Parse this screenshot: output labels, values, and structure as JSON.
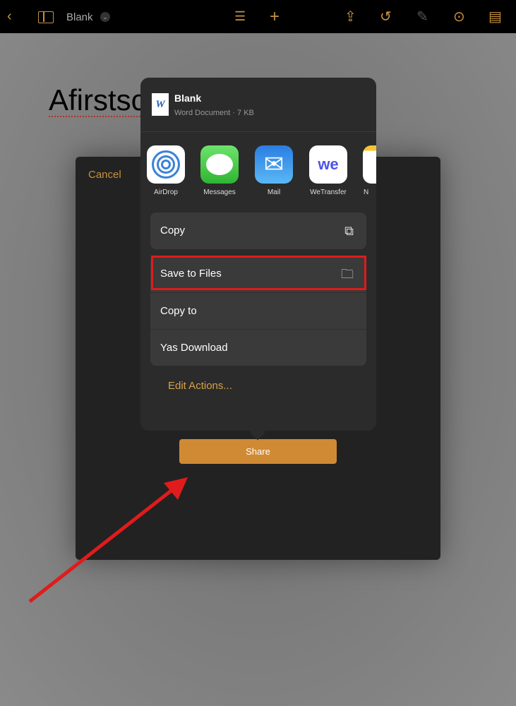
{
  "toolbar": {
    "title": "Blank",
    "icons": [
      "back-chevron",
      "sidebar",
      "chevron-down",
      "list",
      "plus",
      "share",
      "undo",
      "paintbrush",
      "more",
      "document-view"
    ]
  },
  "document": {
    "heading": "Afirstsc"
  },
  "dialog": {
    "cancel": "Cancel",
    "share": "Share"
  },
  "share_sheet": {
    "file_name": "Blank",
    "file_meta": "Word Document · 7 KB",
    "apps": [
      {
        "label": "AirDrop"
      },
      {
        "label": "Messages"
      },
      {
        "label": "Mail"
      },
      {
        "label": "WeTransfer"
      },
      {
        "label": "N"
      }
    ],
    "actions": [
      {
        "label": "Copy",
        "icon": "copy-icon"
      }
    ],
    "actions2": [
      {
        "label": "Save to Files",
        "icon": "folder-icon"
      },
      {
        "label": "Copy to"
      },
      {
        "label": "Yas Download"
      }
    ],
    "edit_actions": "Edit Actions..."
  },
  "annotation": {
    "highlight_color": "#e01b1b",
    "arrow_color": "#e01b1b"
  }
}
